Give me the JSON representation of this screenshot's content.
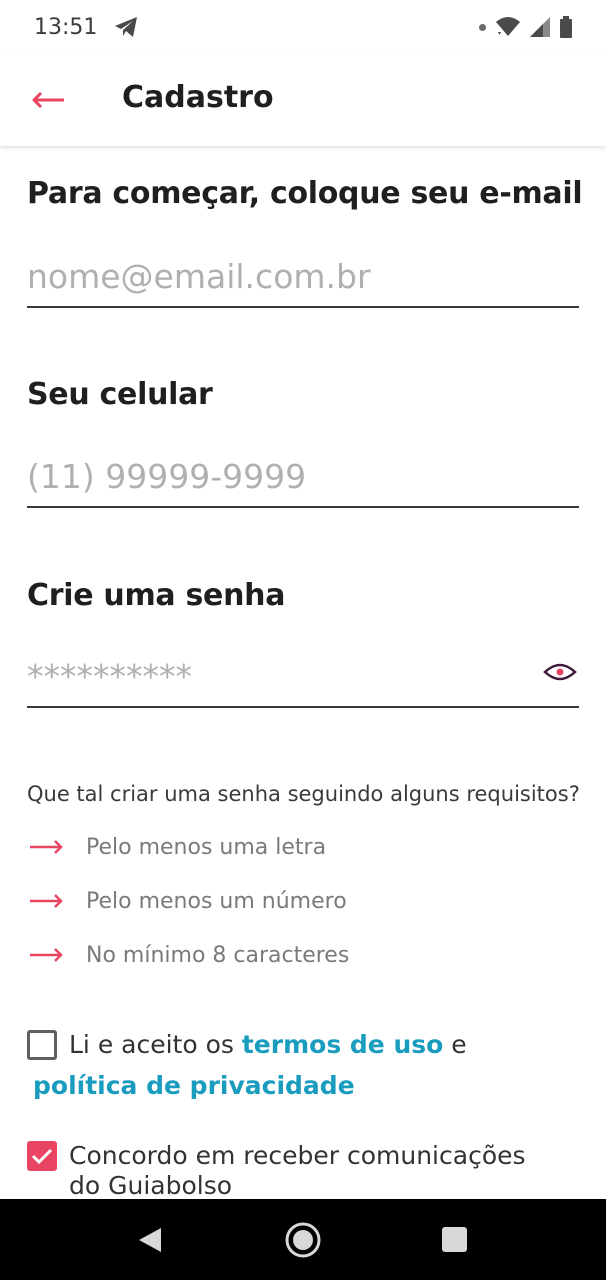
{
  "status_bar": {
    "time": "13:51",
    "icons": [
      "telegram-icon",
      "notification-dot-icon",
      "wifi-icon",
      "signal-icon",
      "battery-icon"
    ]
  },
  "app_bar": {
    "back_icon": "arrow-left-icon",
    "title": "Cadastro"
  },
  "form": {
    "email": {
      "label": "Para começar, coloque seu e-mail",
      "placeholder": "nome@email.com.br",
      "value": ""
    },
    "phone": {
      "label": "Seu celular",
      "placeholder": "(11) 99999-9999",
      "value": ""
    },
    "password": {
      "label": "Crie uma senha",
      "placeholder": "**********",
      "value": "",
      "toggle_icon": "eye-icon"
    },
    "requirements": {
      "intro": "Que tal criar uma senha seguindo alguns requisitos?",
      "items": [
        "Pelo menos uma letra",
        "Pelo menos um número",
        "No mínimo 8 caracteres"
      ]
    },
    "terms": {
      "checked": false,
      "prefix": "Li e aceito os",
      "terms_link": "termos de uso",
      "conjunction": "e",
      "privacy_link": "política de privacidade"
    },
    "communications": {
      "checked": true,
      "text": "Concordo em receber comunicações do Guiabolso"
    }
  },
  "colors": {
    "accent": "#e94563",
    "link": "#1a9cbf",
    "text": "#1f1f1f",
    "placeholder": "#b0b0b0"
  },
  "nav_bar": {
    "buttons": [
      "back-triangle-icon",
      "home-circle-icon",
      "recents-square-icon"
    ]
  }
}
